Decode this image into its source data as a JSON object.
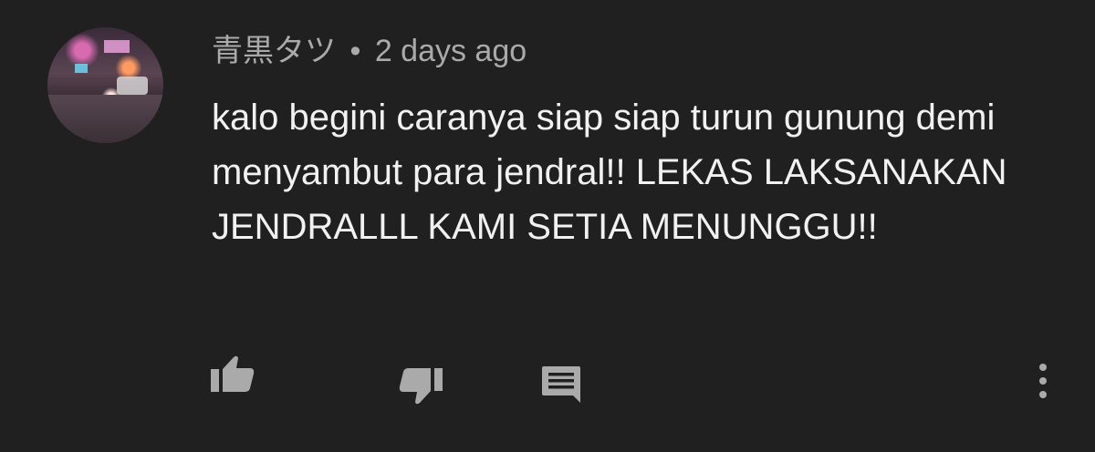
{
  "comment": {
    "author": "青黒タツ",
    "separator": "•",
    "time": "2 days ago",
    "text": "kalo begini caranya siap siap turun gunung demi menyambut para jendral!! LEKAS LAKSANAKAN JENDRALLL KAMI SETIA MENUNGGU!!"
  },
  "actions": {
    "like_icon": "thumb-up-icon",
    "dislike_icon": "thumb-down-icon",
    "reply_icon": "comment-icon",
    "more_icon": "more-vertical-icon"
  },
  "colors": {
    "background": "#202020",
    "text": "#f1f1f1",
    "meta": "#aaaaaa",
    "icon": "#aaaaaa"
  }
}
